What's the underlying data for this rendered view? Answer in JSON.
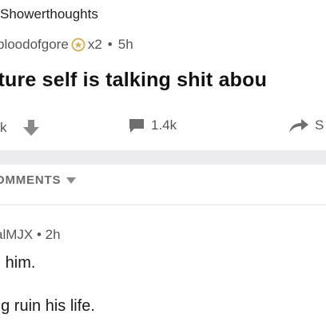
{
  "post": {
    "subreddit": "Showerthoughts",
    "author": "bloodofgore",
    "award_count": "x2",
    "separator": "•",
    "age": "5h",
    "title": "uture self is talking shit abou"
  },
  "actions": {
    "vote_count": "k",
    "comment_count": "1.4k",
    "share_label": "S"
  },
  "comments": {
    "header": "OMMENTS",
    "items": [
      {
        "author": "alMJX",
        "separator": "•",
        "age": "2h",
        "line1": "n him.",
        "line2": "ng ruin his life."
      }
    ]
  },
  "icons": {
    "award": "award-icon",
    "downvote": "downvote-arrow-icon",
    "comment": "comment-bubble-icon",
    "share": "share-arrow-icon",
    "dropdown": "chevron-down-icon"
  },
  "colors": {
    "icon_gray": "#8a8a8a",
    "award_gold": "#d8b25a",
    "band": "#ececef"
  }
}
